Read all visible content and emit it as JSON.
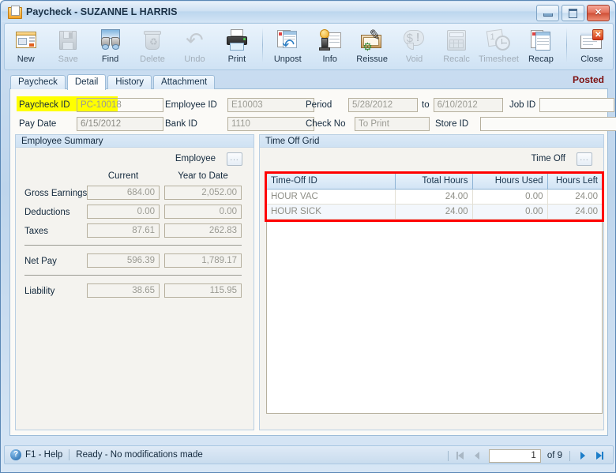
{
  "window": {
    "title": "Paycheck - SUZANNE L HARRIS",
    "icon": "paycheck-window-icon",
    "buttons": {
      "minimize": "–",
      "maximize": "□",
      "close": "✕"
    }
  },
  "toolbar": {
    "items": [
      {
        "label": "New",
        "icon": "new-document-icon",
        "disabled": false
      },
      {
        "label": "Save",
        "icon": "floppy-disk-icon",
        "disabled": true
      },
      {
        "label": "Find",
        "icon": "binoculars-icon",
        "disabled": false
      },
      {
        "label": "Delete",
        "icon": "trash-can-icon",
        "disabled": true
      },
      {
        "label": "Undo",
        "icon": "undo-arrow-icon",
        "disabled": true
      },
      {
        "label": "Print",
        "icon": "printer-icon",
        "disabled": false
      },
      {
        "label": "Unpost",
        "icon": "unpost-icon",
        "disabled": false
      },
      {
        "label": "Info",
        "icon": "info-stamp-icon",
        "disabled": false
      },
      {
        "label": "Reissue",
        "icon": "reissue-pen-icon",
        "disabled": false
      },
      {
        "label": "Void",
        "icon": "void-dollar-icon",
        "disabled": true
      },
      {
        "label": "Recalc",
        "icon": "calculator-icon",
        "disabled": true
      },
      {
        "label": "Timesheet",
        "icon": "timesheet-clock-icon",
        "disabled": true
      },
      {
        "label": "Recap",
        "icon": "recap-report-icon",
        "disabled": false
      },
      {
        "label": "Close",
        "icon": "close-window-icon",
        "disabled": false
      }
    ]
  },
  "tabs": [
    {
      "label": "Paycheck",
      "active": false
    },
    {
      "label": "Detail",
      "active": true
    },
    {
      "label": "History",
      "active": false
    },
    {
      "label": "Attachment",
      "active": false
    }
  ],
  "status_badge": "Posted",
  "header_form": {
    "paycheck_id": {
      "label": "Paycheck ID",
      "value": "PC-10018",
      "highlighted": true
    },
    "pay_date": {
      "label": "Pay Date",
      "value": "6/15/2012"
    },
    "employee_id": {
      "label": "Employee ID",
      "value": "E10003"
    },
    "bank_id": {
      "label": "Bank ID",
      "value": "1110"
    },
    "period": {
      "label": "Period",
      "from": "5/28/2012",
      "to_label": "to",
      "to": "6/10/2012"
    },
    "check_no": {
      "label": "Check No",
      "value": "To Print"
    },
    "job_id": {
      "label": "Job ID",
      "value": ""
    },
    "store_id": {
      "label": "Store ID",
      "value": ""
    }
  },
  "employee_summary": {
    "title": "Employee Summary",
    "employee_label": "Employee",
    "employee_browse_btn": "...",
    "columns": [
      "Current",
      "Year to Date"
    ],
    "rows": [
      {
        "label": "Gross Earnings",
        "current": "684.00",
        "ytd": "2,052.00"
      },
      {
        "label": "Deductions",
        "current": "0.00",
        "ytd": "0.00"
      },
      {
        "label": "Taxes",
        "current": "87.61",
        "ytd": "262.83"
      },
      {
        "label": "Net Pay",
        "current": "596.39",
        "ytd": "1,789.17"
      },
      {
        "label": "Liability",
        "current": "38.65",
        "ytd": "115.95"
      }
    ]
  },
  "time_off": {
    "title": "Time Off Grid",
    "time_off_label": "Time Off",
    "time_off_browse_btn": "...",
    "columns": [
      "Time-Off ID",
      "Total Hours",
      "Hours Used",
      "Hours Left"
    ],
    "rows": [
      {
        "id": "HOUR VAC",
        "total_hours": "24.00",
        "hours_used": "0.00",
        "hours_left": "24.00"
      },
      {
        "id": "HOUR SICK",
        "total_hours": "24.00",
        "hours_used": "0.00",
        "hours_left": "24.00"
      }
    ],
    "highlight_color": "#ff0000"
  },
  "statusbar": {
    "help_icon": "question-mark-icon",
    "help_text": "F1 - Help",
    "status_text": "Ready - No modifications made",
    "nav": {
      "first": "first-record-icon",
      "prev": "previous-record-icon",
      "current_page": "1",
      "of_text": "of 9",
      "next": "next-record-icon",
      "last": "last-record-icon"
    }
  }
}
